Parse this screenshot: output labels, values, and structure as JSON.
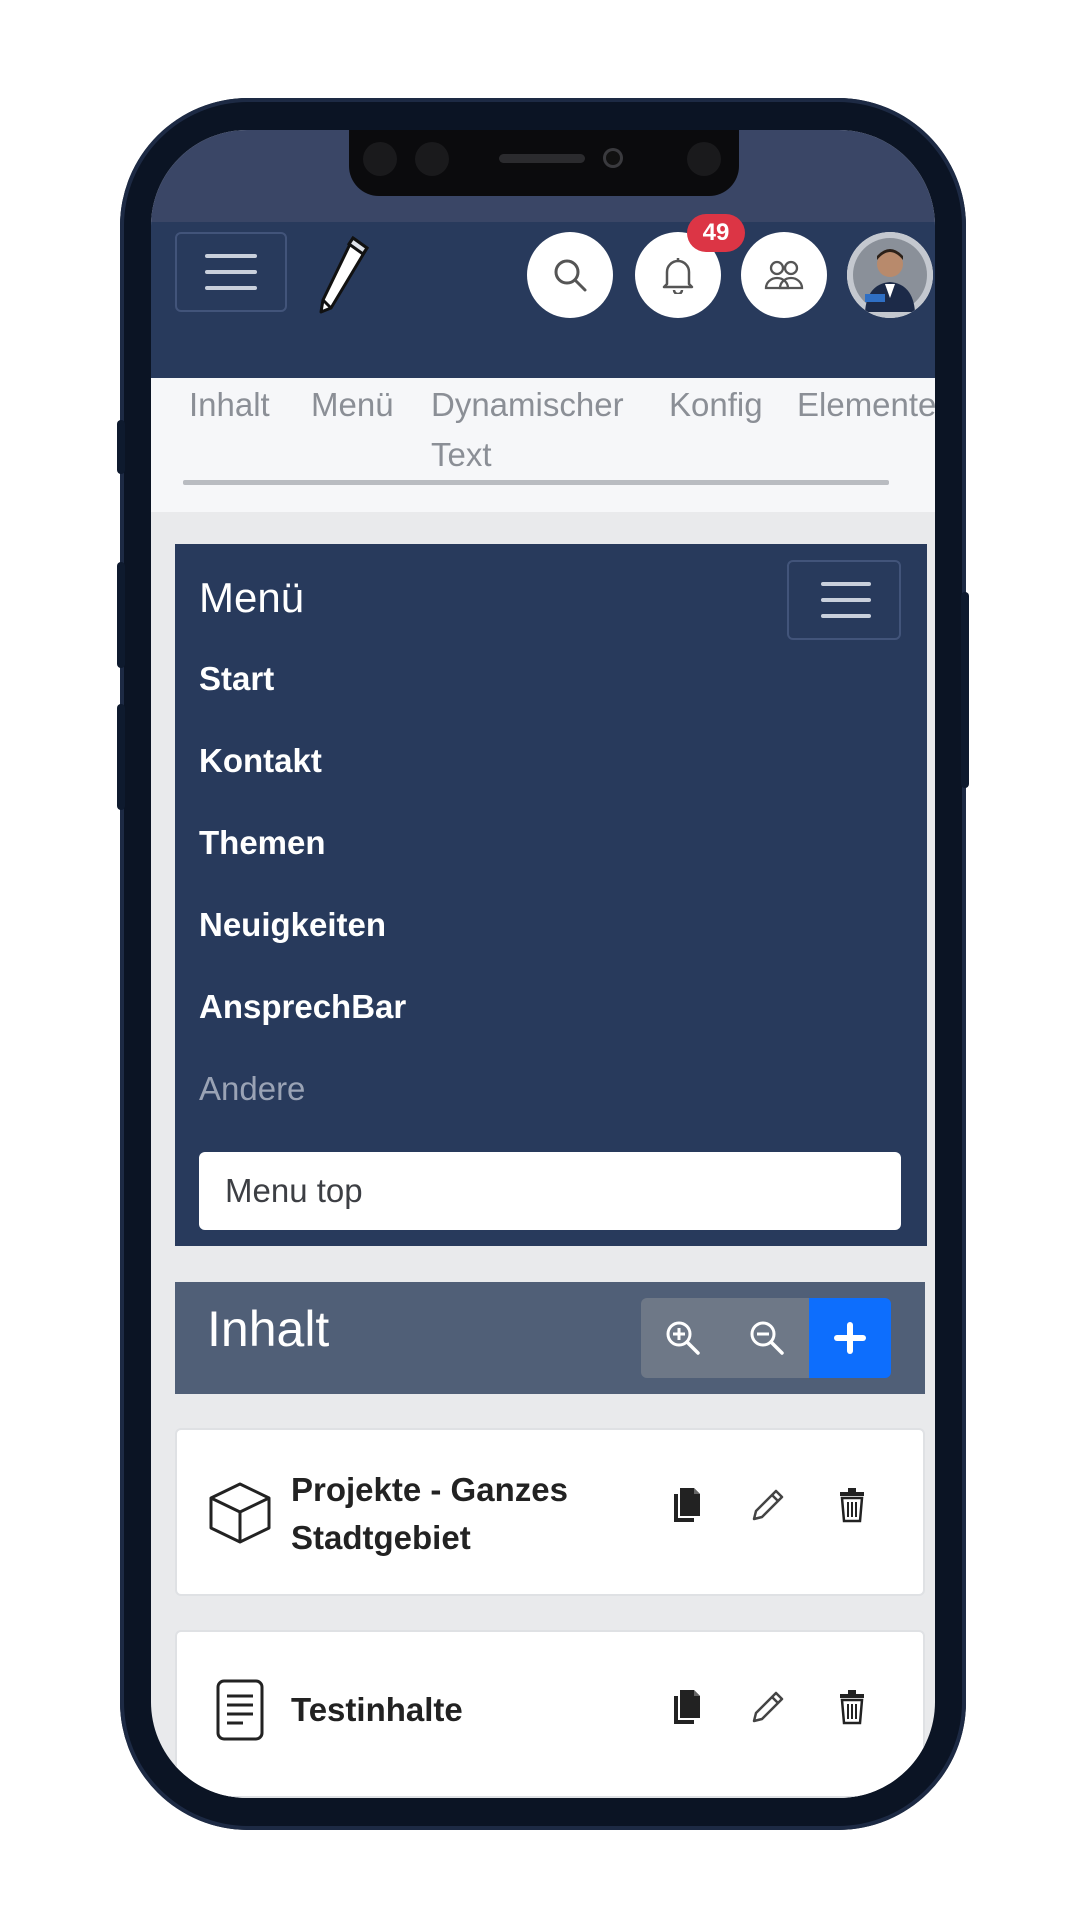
{
  "header": {
    "notification_count": "49",
    "icons": [
      "menu-icon",
      "pen-logo-icon",
      "search-icon",
      "bell-icon",
      "users-icon",
      "avatar"
    ]
  },
  "tabs": [
    {
      "label": "Inhalt"
    },
    {
      "label": "Menü"
    },
    {
      "label": "Dynamischer Text"
    },
    {
      "label": "Konfig"
    },
    {
      "label": "Elemente"
    }
  ],
  "menu": {
    "title": "Menü",
    "items": [
      {
        "label": "Start"
      },
      {
        "label": "Kontakt"
      },
      {
        "label": "Themen"
      },
      {
        "label": "Neuigkeiten"
      },
      {
        "label": "AnsprechBar"
      },
      {
        "label": "Andere"
      }
    ],
    "select_value": "Menu top"
  },
  "content": {
    "title": "Inhalt",
    "items": [
      {
        "title_line1": "Projekte - Ganzes",
        "title_line2": "Stadtgebiet",
        "icon": "cube-icon"
      },
      {
        "title_line1": "Testinhalte",
        "icon": "document-icon"
      }
    ]
  },
  "colors": {
    "navbar": "#283a5c",
    "content_header": "#505f77",
    "primary": "#0d6efd",
    "badge": "#dc3545"
  }
}
